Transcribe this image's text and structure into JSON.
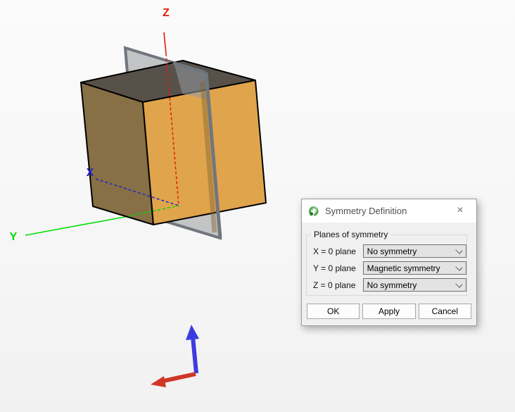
{
  "scene": {
    "axis_labels": {
      "x": "X",
      "y": "Y",
      "z": "Z"
    },
    "colors": {
      "cube_front": "#e0a44c",
      "cube_left": "#877045",
      "cube_top": "#58514a",
      "plane_fill": "#c3c4c6",
      "plane_frame": "#70767e",
      "axis_x": "#2222cc",
      "axis_y": "#00dd00",
      "axis_z": "#e31b0c",
      "triad_up": "#3b3be0",
      "triad_left": "#cf3628"
    }
  },
  "dialog": {
    "title": "Symmetry Definition",
    "close_glyph": "×",
    "group": {
      "label": "Planes of symmetry",
      "rows": [
        {
          "label": "X = 0 plane",
          "value": "No symmetry"
        },
        {
          "label": "Y = 0 plane",
          "value": "Magnetic symmetry"
        },
        {
          "label": "Z = 0 plane",
          "value": "No symmetry"
        }
      ]
    },
    "buttons": {
      "ok": "OK",
      "apply": "Apply",
      "cancel": "Cancel"
    }
  }
}
